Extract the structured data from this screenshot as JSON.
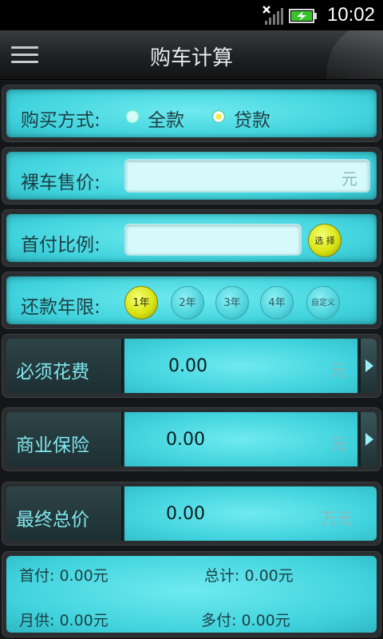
{
  "status_bar": {
    "time": "10:02"
  },
  "header": {
    "title": "购车计算"
  },
  "purchase_method": {
    "label": "购买方式:",
    "options": [
      "全款",
      "贷款"
    ],
    "selected": "贷款"
  },
  "car_price": {
    "label": "裸车售价:",
    "value": "",
    "unit": "元"
  },
  "down_payment_ratio": {
    "label": "首付比例:",
    "value": "",
    "select_button": "选 择"
  },
  "loan_term": {
    "label": "还款年限:",
    "options": [
      "1年",
      "2年",
      "3年",
      "4年",
      "自定义"
    ],
    "selected": "1年"
  },
  "required_fees": {
    "label": "必须花费",
    "value": "0.00",
    "unit": "元"
  },
  "commercial_insurance": {
    "label": "商业保险",
    "value": "0.00",
    "unit": "元"
  },
  "final_total": {
    "label": "最终总价",
    "value": "0.00",
    "unit": "万元"
  },
  "summary": {
    "down_payment": "首付: 0.00元",
    "total": "总计: 0.00元",
    "monthly": "月供: 0.00元",
    "extra": "多付: 0.00元"
  },
  "colors": {
    "accent": "#3fd2dc",
    "selected_ball": "#d9e412",
    "panel_bg": "#2b2e30"
  }
}
